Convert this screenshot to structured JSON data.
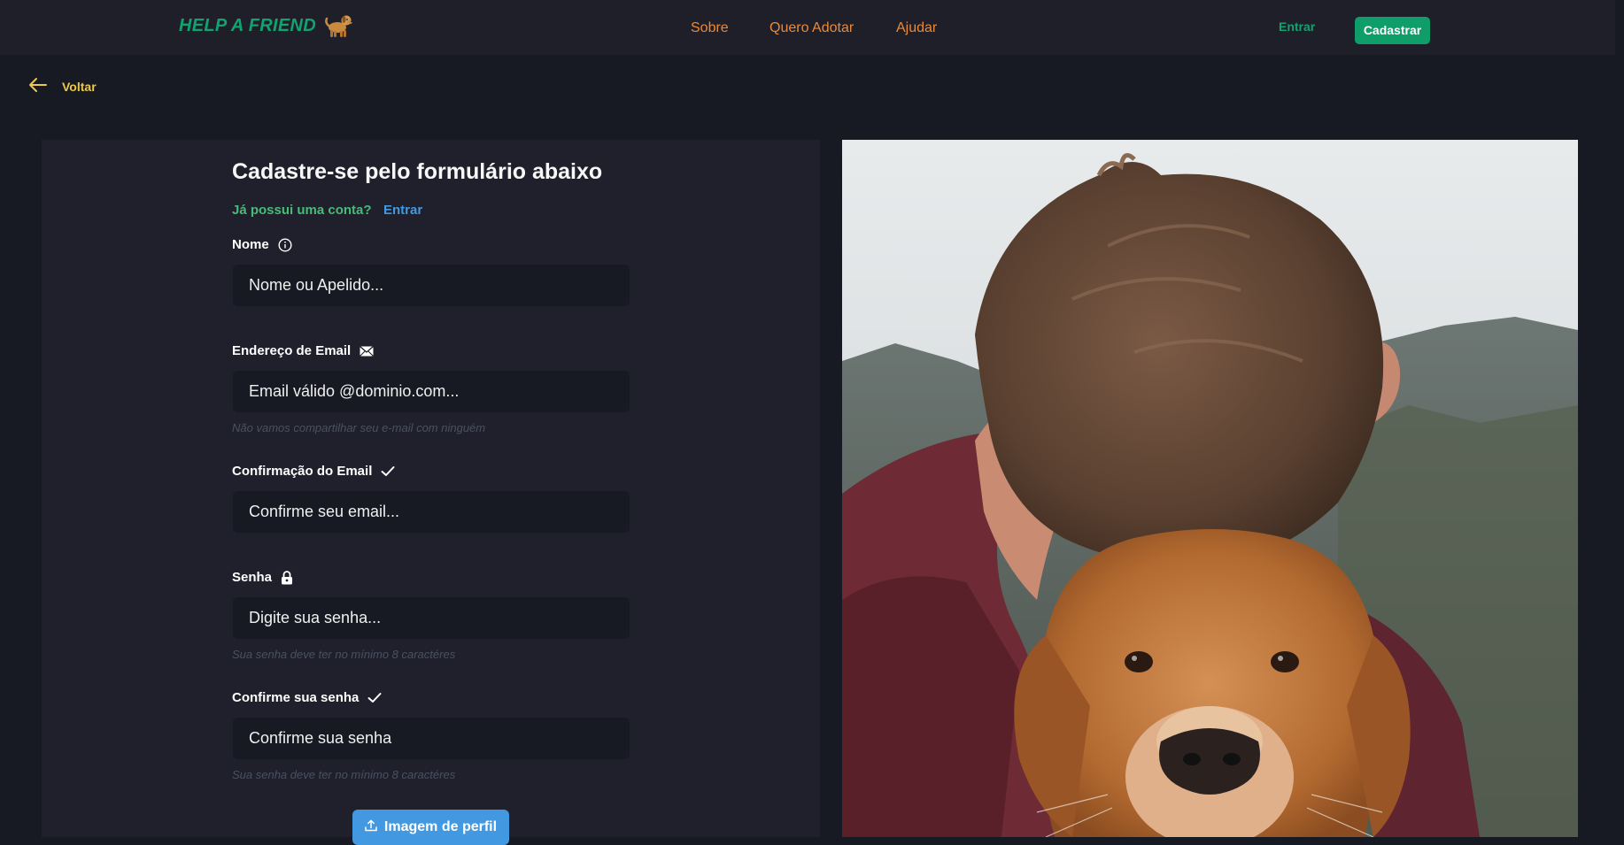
{
  "header": {
    "brand": "HELP A FRIEND",
    "nav": [
      "Sobre",
      "Quero Adotar",
      "Ajudar"
    ],
    "login_label": "Entrar",
    "signup_label": "Cadastrar"
  },
  "back": {
    "label": "Voltar"
  },
  "form": {
    "title": "Cadastre-se pelo formulário abaixo",
    "have_account_text": "Já possui uma conta?",
    "have_account_link": "Entrar",
    "fields": [
      {
        "label": "Nome",
        "icon": "info-icon",
        "placeholder": "Nome ou Apelido...",
        "hint": ""
      },
      {
        "label": "Endereço de Email",
        "icon": "envelope-icon",
        "placeholder": "Email válido @dominio.com...",
        "hint": "Não vamos compartilhar seu e-mail com ninguém"
      },
      {
        "label": "Confirmação do Email",
        "icon": "check-icon",
        "placeholder": "Confirme seu email...",
        "hint": ""
      },
      {
        "label": "Senha",
        "icon": "lock-icon",
        "placeholder": "Digite sua senha...",
        "hint": "Sua senha deve ter no mínimo 8 caractéres"
      },
      {
        "label": "Confirme sua senha",
        "icon": "check-icon",
        "placeholder": "Confirme sua senha",
        "hint": "Sua senha deve ter no mínimo 8 caractéres"
      }
    ],
    "upload_label": "Imagem de perfil"
  },
  "colors": {
    "background": "#171923",
    "header": "#1e1f29",
    "panel": "#1f202b",
    "brand": "#10a36f",
    "nav": "#ed8936",
    "accent_yellow": "#ecc94b",
    "link_blue": "#4299e1",
    "green_text": "#48bb78"
  },
  "image": {
    "icon": "man-hugging-dog-photo"
  }
}
